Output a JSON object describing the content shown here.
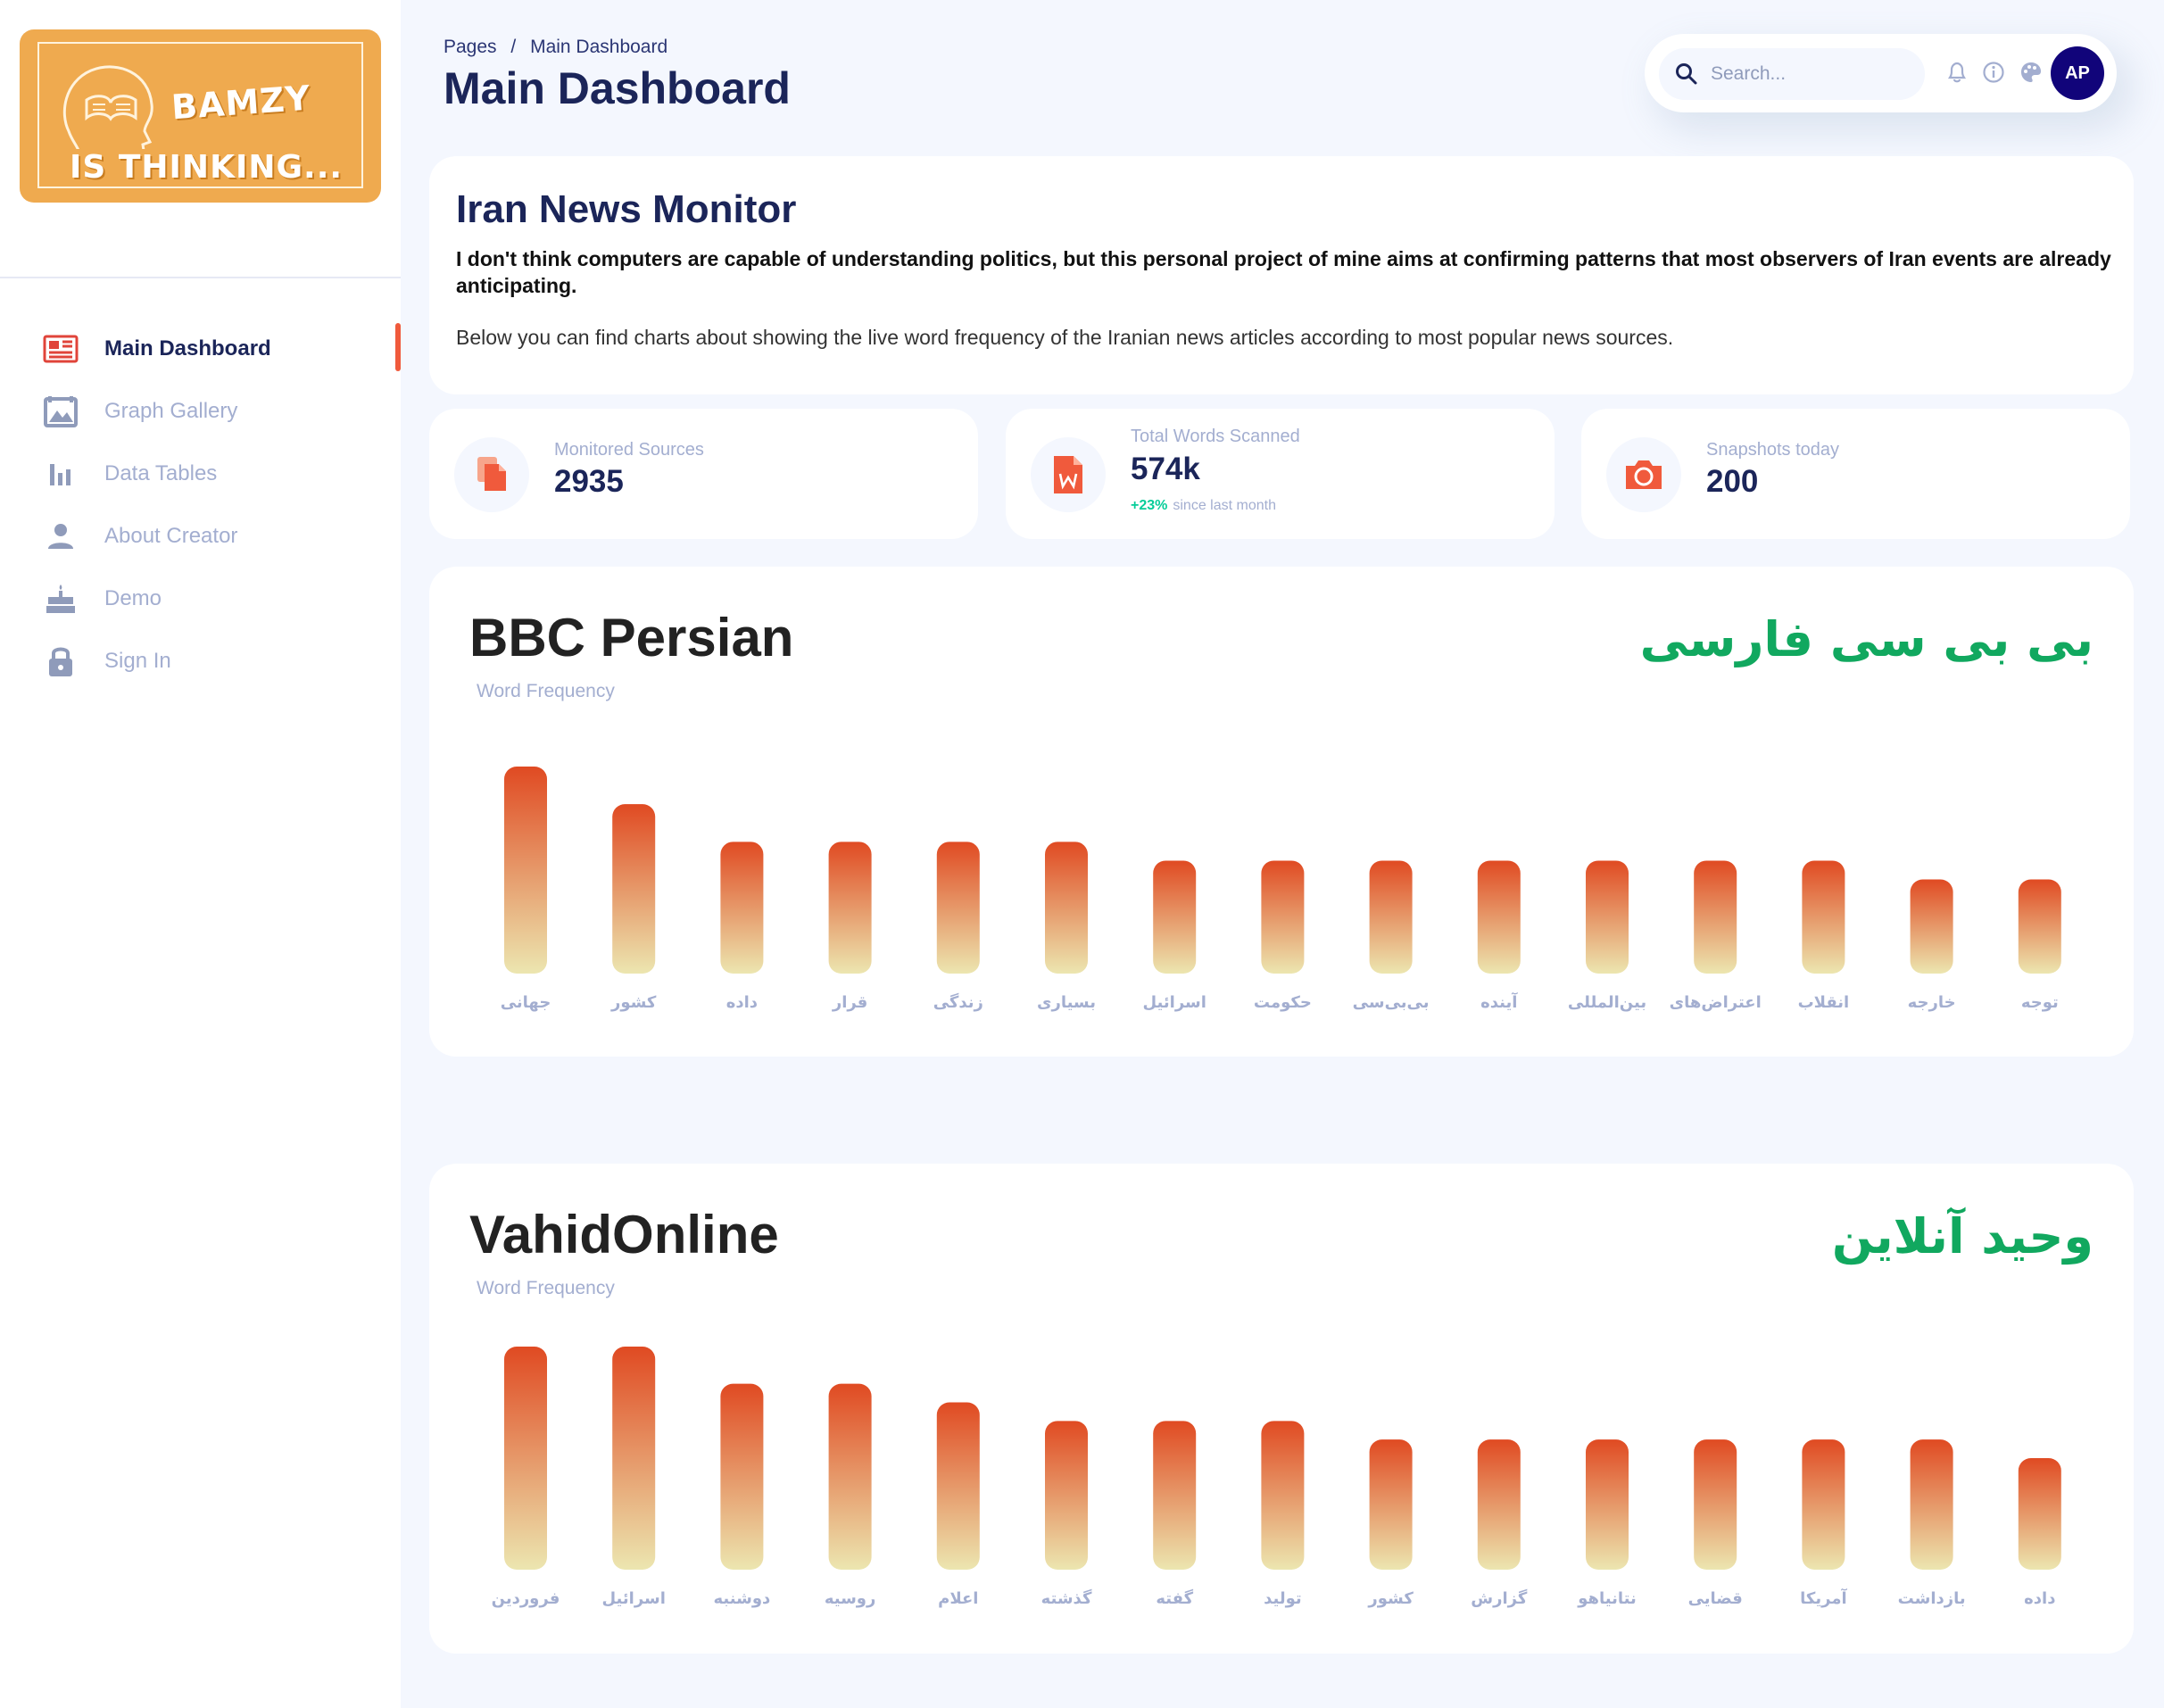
{
  "brand": {
    "logo_line1": "BAMZY",
    "logo_line2": "IS THINKING...",
    "logo_bg": "#efaa4f"
  },
  "sidebar": {
    "items": [
      {
        "label": "Main Dashboard",
        "icon": "newspaper-icon",
        "active": true
      },
      {
        "label": "Graph Gallery",
        "icon": "gallery-icon",
        "active": false
      },
      {
        "label": "Data Tables",
        "icon": "bar-chart-icon",
        "active": false
      },
      {
        "label": "About Creator",
        "icon": "person-icon",
        "active": false
      },
      {
        "label": "Demo",
        "icon": "cake-icon",
        "active": false
      },
      {
        "label": "Sign In",
        "icon": "lock-icon",
        "active": false
      }
    ]
  },
  "header": {
    "breadcrumb": [
      "Pages",
      "/",
      "Main Dashboard"
    ],
    "title": "Main Dashboard",
    "search_placeholder": "Search...",
    "avatar_initials": "AP"
  },
  "intro": {
    "title": "Iran News Monitor",
    "bold_text": "I don't think computers are capable of understanding politics, but this personal project of mine aims at confirming patterns that most observers of Iran events are already anticipating.",
    "text": "Below you can find charts about showing the live word frequency of the Iranian news articles according to most popular news sources."
  },
  "stats": [
    {
      "label": "Monitored Sources",
      "value": "2935",
      "icon": "document-icon"
    },
    {
      "label": "Total Words Scanned",
      "value": "574k",
      "growth": "+23%",
      "growth_text": "since last month",
      "icon": "word-file-icon"
    },
    {
      "label": "Snapshots today",
      "value": "200",
      "icon": "camera-icon"
    }
  ],
  "colors": {
    "accent": "#f05a3c",
    "navy": "#1b2559",
    "muted": "#a3aed0",
    "green": "#11a85f",
    "bar_top": "#e04a22",
    "bar_bottom": "#ece6b0"
  },
  "chart_data": [
    {
      "type": "bar",
      "title": "BBC Persian",
      "title_fa": "بی بی سی فارسی",
      "subtitle": "Word Frequency",
      "categories": [
        "جهانی",
        "کشور",
        "داده",
        "قرار",
        "زندگی",
        "بسیاری",
        "اسرائیل",
        "حکومت",
        "بی‌بی‌سی",
        "آینده",
        "بین‌المللی",
        "اعتراض‌های",
        "انقلاب",
        "خارجه",
        "توجه"
      ],
      "values": [
        11,
        9,
        7,
        7,
        7,
        7,
        6,
        6,
        6,
        6,
        6,
        6,
        6,
        5,
        5
      ],
      "ylim": [
        0,
        11
      ],
      "grid": false,
      "yaxis_visible": false
    },
    {
      "type": "bar",
      "title": "VahidOnline",
      "title_fa": "وحید آنلاین",
      "subtitle": "Word Frequency",
      "categories": [
        "فروردین",
        "اسرائیل",
        "دوشنبه",
        "روسیه",
        "اعلام",
        "گذشته",
        "گفته",
        "تولید",
        "کشور",
        "گزارش",
        "نتانیاهو",
        "قضایی",
        "آمریکا",
        "بازداشت",
        "داده"
      ],
      "values": [
        12,
        12,
        10,
        10,
        9,
        8,
        8,
        8,
        7,
        7,
        7,
        7,
        7,
        7,
        6
      ],
      "ylim": [
        0,
        12
      ],
      "grid": false,
      "yaxis_visible": false
    }
  ]
}
